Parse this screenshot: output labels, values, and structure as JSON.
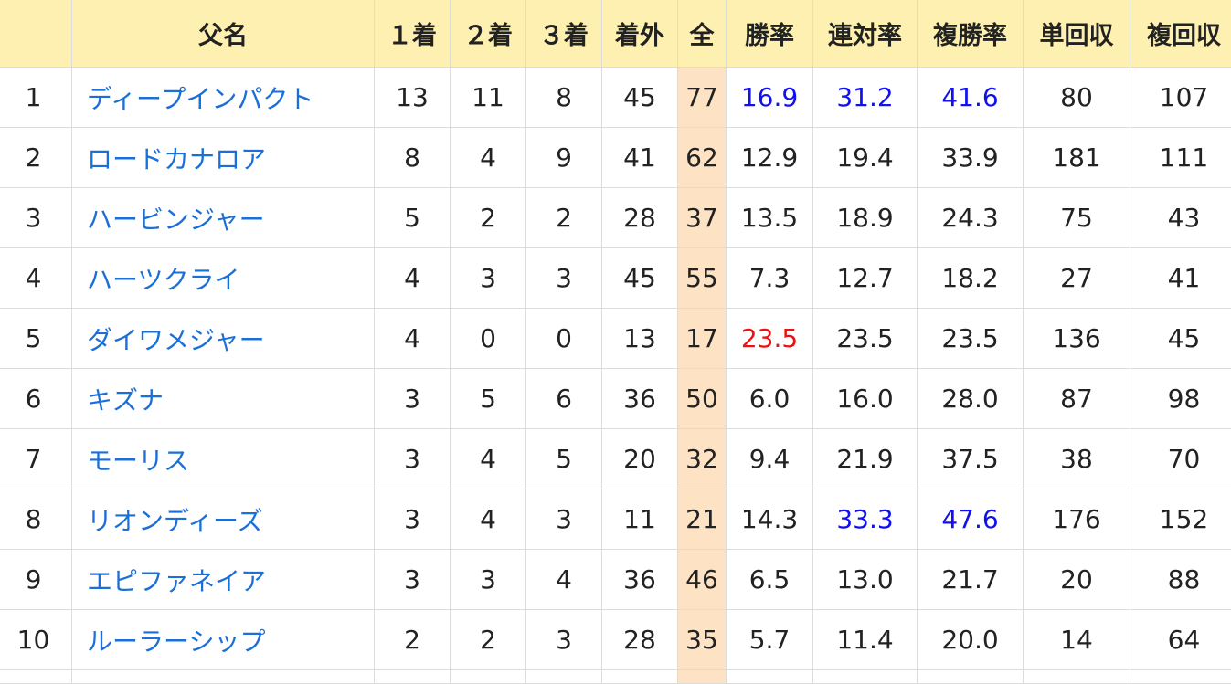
{
  "header": {
    "rank": "",
    "name": "父名",
    "first": "１着",
    "second": "２着",
    "third": "３着",
    "outside": "着外",
    "total": "全",
    "win_rate": "勝率",
    "quinella_rate": "連対率",
    "place_rate": "複勝率",
    "win_return": "単回収",
    "place_return": "複回収"
  },
  "colors": {
    "header_bg": "#fdf0b0",
    "total_col_bg": "#fde3c3",
    "link": "#1a6fd8",
    "highlight_blue": "#1111ee",
    "highlight_red": "#ee1111"
  },
  "rows": [
    {
      "rank": "1",
      "name": "ディープインパクト",
      "first": "13",
      "second": "11",
      "third": "8",
      "outside": "45",
      "total": "77",
      "win_rate": "16.9",
      "quinella_rate": "31.2",
      "place_rate": "41.6",
      "win_return": "80",
      "place_return": "107",
      "win_rate_color": "blue",
      "quinella_rate_color": "blue",
      "place_rate_color": "blue"
    },
    {
      "rank": "2",
      "name": "ロードカナロア",
      "first": "8",
      "second": "4",
      "third": "9",
      "outside": "41",
      "total": "62",
      "win_rate": "12.9",
      "quinella_rate": "19.4",
      "place_rate": "33.9",
      "win_return": "181",
      "place_return": "111",
      "win_rate_color": "",
      "quinella_rate_color": "",
      "place_rate_color": ""
    },
    {
      "rank": "3",
      "name": "ハービンジャー",
      "first": "5",
      "second": "2",
      "third": "2",
      "outside": "28",
      "total": "37",
      "win_rate": "13.5",
      "quinella_rate": "18.9",
      "place_rate": "24.3",
      "win_return": "75",
      "place_return": "43",
      "win_rate_color": "",
      "quinella_rate_color": "",
      "place_rate_color": ""
    },
    {
      "rank": "4",
      "name": "ハーツクライ",
      "first": "4",
      "second": "3",
      "third": "3",
      "outside": "45",
      "total": "55",
      "win_rate": "7.3",
      "quinella_rate": "12.7",
      "place_rate": "18.2",
      "win_return": "27",
      "place_return": "41",
      "win_rate_color": "",
      "quinella_rate_color": "",
      "place_rate_color": ""
    },
    {
      "rank": "5",
      "name": "ダイワメジャー",
      "first": "4",
      "second": "0",
      "third": "0",
      "outside": "13",
      "total": "17",
      "win_rate": "23.5",
      "quinella_rate": "23.5",
      "place_rate": "23.5",
      "win_return": "136",
      "place_return": "45",
      "win_rate_color": "red",
      "quinella_rate_color": "",
      "place_rate_color": ""
    },
    {
      "rank": "6",
      "name": "キズナ",
      "first": "3",
      "second": "5",
      "third": "6",
      "outside": "36",
      "total": "50",
      "win_rate": "6.0",
      "quinella_rate": "16.0",
      "place_rate": "28.0",
      "win_return": "87",
      "place_return": "98",
      "win_rate_color": "",
      "quinella_rate_color": "",
      "place_rate_color": ""
    },
    {
      "rank": "7",
      "name": "モーリス",
      "first": "3",
      "second": "4",
      "third": "5",
      "outside": "20",
      "total": "32",
      "win_rate": "9.4",
      "quinella_rate": "21.9",
      "place_rate": "37.5",
      "win_return": "38",
      "place_return": "70",
      "win_rate_color": "",
      "quinella_rate_color": "",
      "place_rate_color": ""
    },
    {
      "rank": "8",
      "name": "リオンディーズ",
      "first": "3",
      "second": "4",
      "third": "3",
      "outside": "11",
      "total": "21",
      "win_rate": "14.3",
      "quinella_rate": "33.3",
      "place_rate": "47.6",
      "win_return": "176",
      "place_return": "152",
      "win_rate_color": "",
      "quinella_rate_color": "blue",
      "place_rate_color": "blue"
    },
    {
      "rank": "9",
      "name": "エピファネイア",
      "first": "3",
      "second": "3",
      "third": "4",
      "outside": "36",
      "total": "46",
      "win_rate": "6.5",
      "quinella_rate": "13.0",
      "place_rate": "21.7",
      "win_return": "20",
      "place_return": "88",
      "win_rate_color": "",
      "quinella_rate_color": "",
      "place_rate_color": ""
    },
    {
      "rank": "10",
      "name": "ルーラーシップ",
      "first": "2",
      "second": "2",
      "third": "3",
      "outside": "28",
      "total": "35",
      "win_rate": "5.7",
      "quinella_rate": "11.4",
      "place_rate": "20.0",
      "win_return": "14",
      "place_return": "64",
      "win_rate_color": "",
      "quinella_rate_color": "",
      "place_rate_color": ""
    }
  ]
}
